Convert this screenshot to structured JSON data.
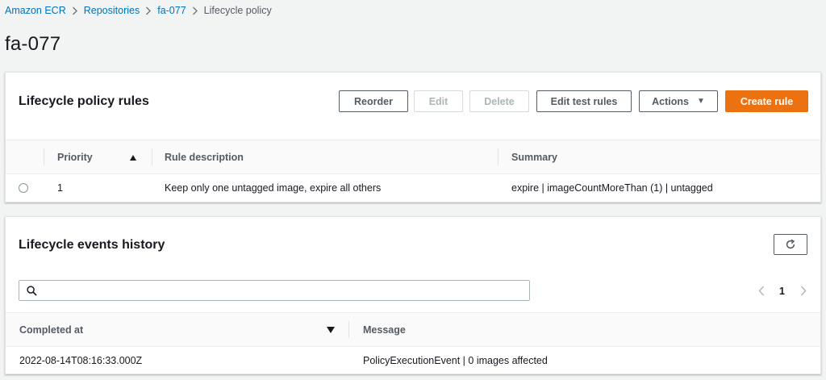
{
  "breadcrumb": {
    "items": [
      "Amazon ECR",
      "Repositories",
      "fa-077"
    ],
    "current": "Lifecycle policy"
  },
  "page_title": "fa-077",
  "rules_panel": {
    "title": "Lifecycle policy rules",
    "buttons": {
      "reorder": "Reorder",
      "edit": "Edit",
      "delete": "Delete",
      "edit_test_rules": "Edit test rules",
      "actions": "Actions",
      "create_rule": "Create rule"
    },
    "columns": [
      "Priority",
      "Rule description",
      "Summary"
    ],
    "rows": [
      {
        "priority": "1",
        "description": "Keep only one untagged image, expire all others",
        "summary": "expire | imageCountMoreThan (1) | untagged"
      }
    ]
  },
  "events_panel": {
    "title": "Lifecycle events history",
    "search": {
      "value": "",
      "placeholder": ""
    },
    "pagination": {
      "current_page": "1"
    },
    "columns": [
      "Completed at",
      "Message"
    ],
    "rows": [
      {
        "completed_at": "2022-08-14T08:16:33.000Z",
        "message": "PolicyExecutionEvent | 0 images affected"
      }
    ]
  },
  "icons": {
    "breadcrumb_separator": "chevron-right-icon",
    "sort_ascending": "caret-up-icon",
    "sort_descending": "caret-down-icon",
    "refresh": "refresh-icon",
    "search": "search-icon",
    "page_prev": "chevron-left-icon",
    "page_next": "chevron-right-icon"
  },
  "colors": {
    "link": "#0073bb",
    "primary_button": "#ec7211",
    "background": "#f2f3f3"
  }
}
